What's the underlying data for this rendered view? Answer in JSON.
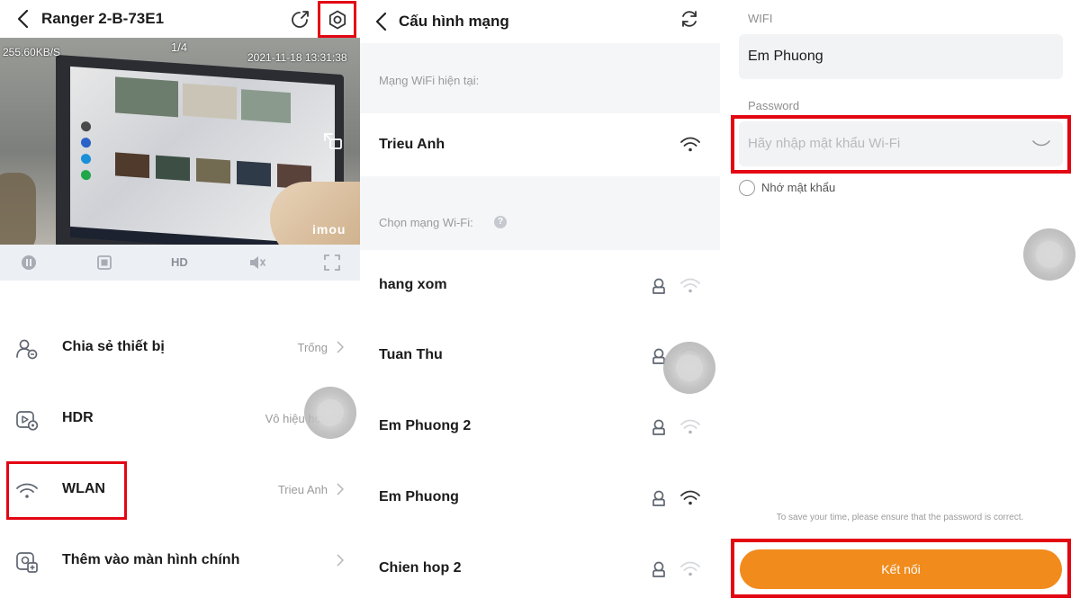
{
  "panel1": {
    "title": "Ranger 2-B-73E1",
    "video": {
      "speed": "255.60KB/S",
      "page_indicator": "1/4",
      "timestamp": "2021-11-18 13:31:38",
      "logo": "imou"
    },
    "controls": {
      "hd_label": "HD"
    },
    "menu": [
      {
        "label": "Chia sẻ thiết bị",
        "value": "Trống",
        "icon": "share-device-icon"
      },
      {
        "label": "HDR",
        "value": "Vô hiệu hóa",
        "icon": "hdr-icon"
      },
      {
        "label": "WLAN",
        "value": "Trieu Anh",
        "icon": "wifi-icon"
      },
      {
        "label": "Thêm vào màn hình chính",
        "value": "",
        "icon": "add-home-icon"
      }
    ]
  },
  "panel2": {
    "title": "Cấu hình mạng",
    "current_label": "Mạng WiFi hiện tại:",
    "current_network": "Trieu Anh",
    "choose_label": "Chọn mạng Wi-Fi:",
    "help_glyph": "?",
    "networks": [
      {
        "name": "hang xom",
        "signal": "weak"
      },
      {
        "name": "Tuan Thu",
        "signal": "weak"
      },
      {
        "name": "Em Phuong 2",
        "signal": "weak"
      },
      {
        "name": "Em Phuong",
        "signal": "strong"
      },
      {
        "name": "Chien hop 2",
        "signal": "weak"
      }
    ]
  },
  "panel3": {
    "wifi_label": "WIFI",
    "wifi_value": "Em Phuong",
    "password_label": "Password",
    "password_placeholder": "Hãy nhập mật khẩu Wi-Fi",
    "remember_label": "Nhớ mật khẩu",
    "note": "To save your time, please ensure that the password is correct.",
    "connect_label": "Kết nối"
  },
  "colors": {
    "highlight": "#e30613",
    "accent": "#f18b1c",
    "icon_gray": "#5f6670",
    "muted_text": "#9a9a9a"
  }
}
